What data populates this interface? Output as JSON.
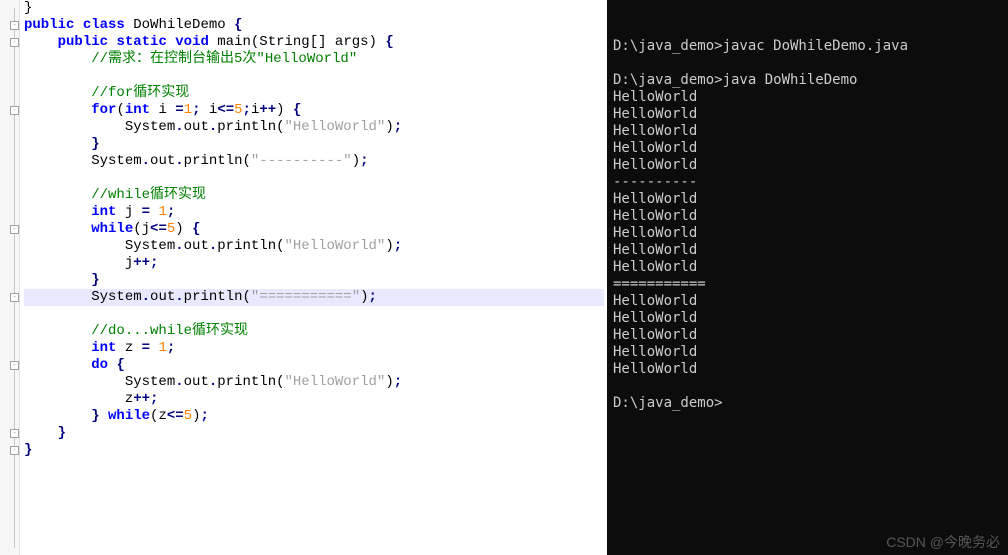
{
  "editor": {
    "lines": [
      {
        "indent": 0,
        "tokens": [
          {
            "t": "}",
            "c": "ident"
          }
        ]
      },
      {
        "indent": 0,
        "tokens": [
          {
            "t": "public",
            "c": "kw"
          },
          {
            "t": " ",
            "c": ""
          },
          {
            "t": "class",
            "c": "kw"
          },
          {
            "t": " ",
            "c": ""
          },
          {
            "t": "DoWhileDemo",
            "c": "ident"
          },
          {
            "t": " ",
            "c": ""
          },
          {
            "t": "{",
            "c": "op"
          }
        ]
      },
      {
        "indent": 4,
        "tokens": [
          {
            "t": "public",
            "c": "kw"
          },
          {
            "t": " ",
            "c": ""
          },
          {
            "t": "static",
            "c": "kw"
          },
          {
            "t": " ",
            "c": ""
          },
          {
            "t": "void",
            "c": "kw"
          },
          {
            "t": " ",
            "c": ""
          },
          {
            "t": "main",
            "c": "ident"
          },
          {
            "t": "(",
            "c": "paren"
          },
          {
            "t": "String",
            "c": "ident"
          },
          {
            "t": "[]",
            "c": "paren"
          },
          {
            "t": " args",
            "c": "ident"
          },
          {
            "t": ")",
            "c": "paren"
          },
          {
            "t": " ",
            "c": ""
          },
          {
            "t": "{",
            "c": "op"
          }
        ]
      },
      {
        "indent": 8,
        "tokens": [
          {
            "t": "//需求：在控制台输出5次\"HelloWorld\"",
            "c": "comment"
          }
        ]
      },
      {
        "indent": 0,
        "tokens": []
      },
      {
        "indent": 8,
        "tokens": [
          {
            "t": "//for循环实现",
            "c": "comment"
          }
        ]
      },
      {
        "indent": 8,
        "tokens": [
          {
            "t": "for",
            "c": "kw"
          },
          {
            "t": "(",
            "c": "paren"
          },
          {
            "t": "int",
            "c": "kw"
          },
          {
            "t": " i ",
            "c": "ident"
          },
          {
            "t": "=",
            "c": "op"
          },
          {
            "t": "1",
            "c": "num"
          },
          {
            "t": ";",
            "c": "op"
          },
          {
            "t": " i",
            "c": "ident"
          },
          {
            "t": "<=",
            "c": "op"
          },
          {
            "t": "5",
            "c": "num"
          },
          {
            "t": ";",
            "c": "op"
          },
          {
            "t": "i",
            "c": "ident"
          },
          {
            "t": "++",
            "c": "op"
          },
          {
            "t": ")",
            "c": "paren"
          },
          {
            "t": " ",
            "c": ""
          },
          {
            "t": "{",
            "c": "op"
          }
        ]
      },
      {
        "indent": 12,
        "tokens": [
          {
            "t": "System",
            "c": "ident"
          },
          {
            "t": ".",
            "c": "op"
          },
          {
            "t": "out",
            "c": "ident"
          },
          {
            "t": ".",
            "c": "op"
          },
          {
            "t": "println",
            "c": "ident"
          },
          {
            "t": "(",
            "c": "paren"
          },
          {
            "t": "\"HelloWorld\"",
            "c": "str"
          },
          {
            "t": ")",
            "c": "paren"
          },
          {
            "t": ";",
            "c": "op"
          }
        ]
      },
      {
        "indent": 8,
        "tokens": [
          {
            "t": "}",
            "c": "op"
          }
        ]
      },
      {
        "indent": 8,
        "tokens": [
          {
            "t": "System",
            "c": "ident"
          },
          {
            "t": ".",
            "c": "op"
          },
          {
            "t": "out",
            "c": "ident"
          },
          {
            "t": ".",
            "c": "op"
          },
          {
            "t": "println",
            "c": "ident"
          },
          {
            "t": "(",
            "c": "paren"
          },
          {
            "t": "\"----------\"",
            "c": "str"
          },
          {
            "t": ")",
            "c": "paren"
          },
          {
            "t": ";",
            "c": "op"
          }
        ]
      },
      {
        "indent": 0,
        "tokens": []
      },
      {
        "indent": 8,
        "tokens": [
          {
            "t": "//while循环实现",
            "c": "comment"
          }
        ]
      },
      {
        "indent": 8,
        "tokens": [
          {
            "t": "int",
            "c": "kw"
          },
          {
            "t": " j ",
            "c": "ident"
          },
          {
            "t": "=",
            "c": "op"
          },
          {
            "t": " ",
            "c": ""
          },
          {
            "t": "1",
            "c": "num"
          },
          {
            "t": ";",
            "c": "op"
          }
        ]
      },
      {
        "indent": 8,
        "tokens": [
          {
            "t": "while",
            "c": "kw"
          },
          {
            "t": "(",
            "c": "paren"
          },
          {
            "t": "j",
            "c": "ident"
          },
          {
            "t": "<=",
            "c": "op"
          },
          {
            "t": "5",
            "c": "num"
          },
          {
            "t": ")",
            "c": "paren"
          },
          {
            "t": " ",
            "c": ""
          },
          {
            "t": "{",
            "c": "op"
          }
        ]
      },
      {
        "indent": 12,
        "tokens": [
          {
            "t": "System",
            "c": "ident"
          },
          {
            "t": ".",
            "c": "op"
          },
          {
            "t": "out",
            "c": "ident"
          },
          {
            "t": ".",
            "c": "op"
          },
          {
            "t": "println",
            "c": "ident"
          },
          {
            "t": "(",
            "c": "paren"
          },
          {
            "t": "\"HelloWorld\"",
            "c": "str"
          },
          {
            "t": ")",
            "c": "paren"
          },
          {
            "t": ";",
            "c": "op"
          }
        ]
      },
      {
        "indent": 12,
        "tokens": [
          {
            "t": "j",
            "c": "ident"
          },
          {
            "t": "++",
            "c": "op"
          },
          {
            "t": ";",
            "c": "op"
          }
        ]
      },
      {
        "indent": 8,
        "tokens": [
          {
            "t": "}",
            "c": "op"
          }
        ]
      },
      {
        "indent": 8,
        "hl": true,
        "tokens": [
          {
            "t": "System",
            "c": "ident"
          },
          {
            "t": ".",
            "c": "op"
          },
          {
            "t": "out",
            "c": "ident"
          },
          {
            "t": ".",
            "c": "op"
          },
          {
            "t": "println",
            "c": "ident"
          },
          {
            "t": "(",
            "c": "paren"
          },
          {
            "t": "\"===========\"",
            "c": "str"
          },
          {
            "t": ")",
            "c": "paren"
          },
          {
            "t": ";",
            "c": "op"
          }
        ]
      },
      {
        "indent": 0,
        "tokens": []
      },
      {
        "indent": 8,
        "tokens": [
          {
            "t": "//do...while循环实现",
            "c": "comment"
          }
        ]
      },
      {
        "indent": 8,
        "tokens": [
          {
            "t": "int",
            "c": "kw"
          },
          {
            "t": " z ",
            "c": "ident"
          },
          {
            "t": "=",
            "c": "op"
          },
          {
            "t": " ",
            "c": ""
          },
          {
            "t": "1",
            "c": "num"
          },
          {
            "t": ";",
            "c": "op"
          }
        ]
      },
      {
        "indent": 8,
        "tokens": [
          {
            "t": "do",
            "c": "kw"
          },
          {
            "t": " ",
            "c": ""
          },
          {
            "t": "{",
            "c": "op"
          }
        ]
      },
      {
        "indent": 12,
        "tokens": [
          {
            "t": "System",
            "c": "ident"
          },
          {
            "t": ".",
            "c": "op"
          },
          {
            "t": "out",
            "c": "ident"
          },
          {
            "t": ".",
            "c": "op"
          },
          {
            "t": "println",
            "c": "ident"
          },
          {
            "t": "(",
            "c": "paren"
          },
          {
            "t": "\"HelloWorld\"",
            "c": "str"
          },
          {
            "t": ")",
            "c": "paren"
          },
          {
            "t": ";",
            "c": "op"
          }
        ]
      },
      {
        "indent": 12,
        "tokens": [
          {
            "t": "z",
            "c": "ident"
          },
          {
            "t": "++",
            "c": "op"
          },
          {
            "t": ";",
            "c": "op"
          }
        ]
      },
      {
        "indent": 8,
        "tokens": [
          {
            "t": "}",
            "c": "op"
          },
          {
            "t": " ",
            "c": ""
          },
          {
            "t": "while",
            "c": "kw"
          },
          {
            "t": "(",
            "c": "paren"
          },
          {
            "t": "z",
            "c": "ident"
          },
          {
            "t": "<=",
            "c": "op"
          },
          {
            "t": "5",
            "c": "num"
          },
          {
            "t": ")",
            "c": "paren"
          },
          {
            "t": ";",
            "c": "op"
          }
        ]
      },
      {
        "indent": 4,
        "tokens": [
          {
            "t": "}",
            "c": "op"
          }
        ]
      },
      {
        "indent": 0,
        "tokens": [
          {
            "t": "}",
            "c": "op"
          }
        ]
      }
    ],
    "fold_positions": [
      1,
      2,
      6,
      13,
      17,
      21,
      25,
      26
    ]
  },
  "terminal": {
    "lines": [
      "D:\\java_demo>javac DoWhileDemo.java",
      "",
      "D:\\java_demo>java DoWhileDemo",
      "HelloWorld",
      "HelloWorld",
      "HelloWorld",
      "HelloWorld",
      "HelloWorld",
      "----------",
      "HelloWorld",
      "HelloWorld",
      "HelloWorld",
      "HelloWorld",
      "HelloWorld",
      "===========",
      "HelloWorld",
      "HelloWorld",
      "HelloWorld",
      "HelloWorld",
      "HelloWorld",
      "",
      "D:\\java_demo>"
    ]
  },
  "watermark": "CSDN @今晚务必"
}
